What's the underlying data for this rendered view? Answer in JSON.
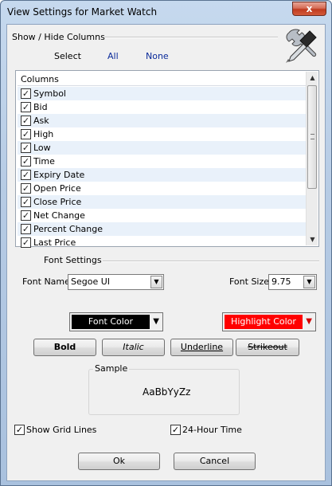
{
  "window": {
    "title": "View Settings for Market Watch",
    "close_label": "x"
  },
  "columns_group": {
    "title": "Show / Hide Columns",
    "select_label": "Select",
    "all_label": "All",
    "none_label": "None",
    "list_header": "Columns",
    "items": [
      {
        "label": "Symbol",
        "checked": true
      },
      {
        "label": "Bid",
        "checked": true
      },
      {
        "label": "Ask",
        "checked": true
      },
      {
        "label": "High",
        "checked": true
      },
      {
        "label": "Low",
        "checked": true
      },
      {
        "label": "Time",
        "checked": true
      },
      {
        "label": "Expiry Date",
        "checked": true
      },
      {
        "label": "Open Price",
        "checked": true
      },
      {
        "label": "Close Price",
        "checked": true
      },
      {
        "label": "Net Change",
        "checked": true
      },
      {
        "label": "Percent Change",
        "checked": true
      },
      {
        "label": "Last Price",
        "checked": true
      }
    ]
  },
  "font_settings": {
    "title": "Font Settings",
    "font_name_label": "Font Name",
    "font_name_value": "Segoe UI",
    "font_size_label": "Font Size",
    "font_size_value": "9.75",
    "font_color_label": "Font Color",
    "font_color": "#000000",
    "highlight_color_label": "Highlight Color",
    "highlight_color": "#ff0000",
    "bold_label": "Bold",
    "italic_label": "Italic",
    "underline_label": "Underline",
    "strikeout_label": "Strikeout",
    "sample_label": "Sample",
    "sample_text": "AaBbYyZz"
  },
  "options": {
    "grid_lines_label": "Show Grid Lines",
    "grid_lines_checked": true,
    "hour24_label": "24-Hour Time",
    "hour24_checked": true
  },
  "actions": {
    "ok_label": "Ok",
    "cancel_label": "Cancel"
  },
  "icons": {
    "tools": "tools-icon",
    "dropdown": "chevron-down-icon",
    "check": "check-icon"
  }
}
